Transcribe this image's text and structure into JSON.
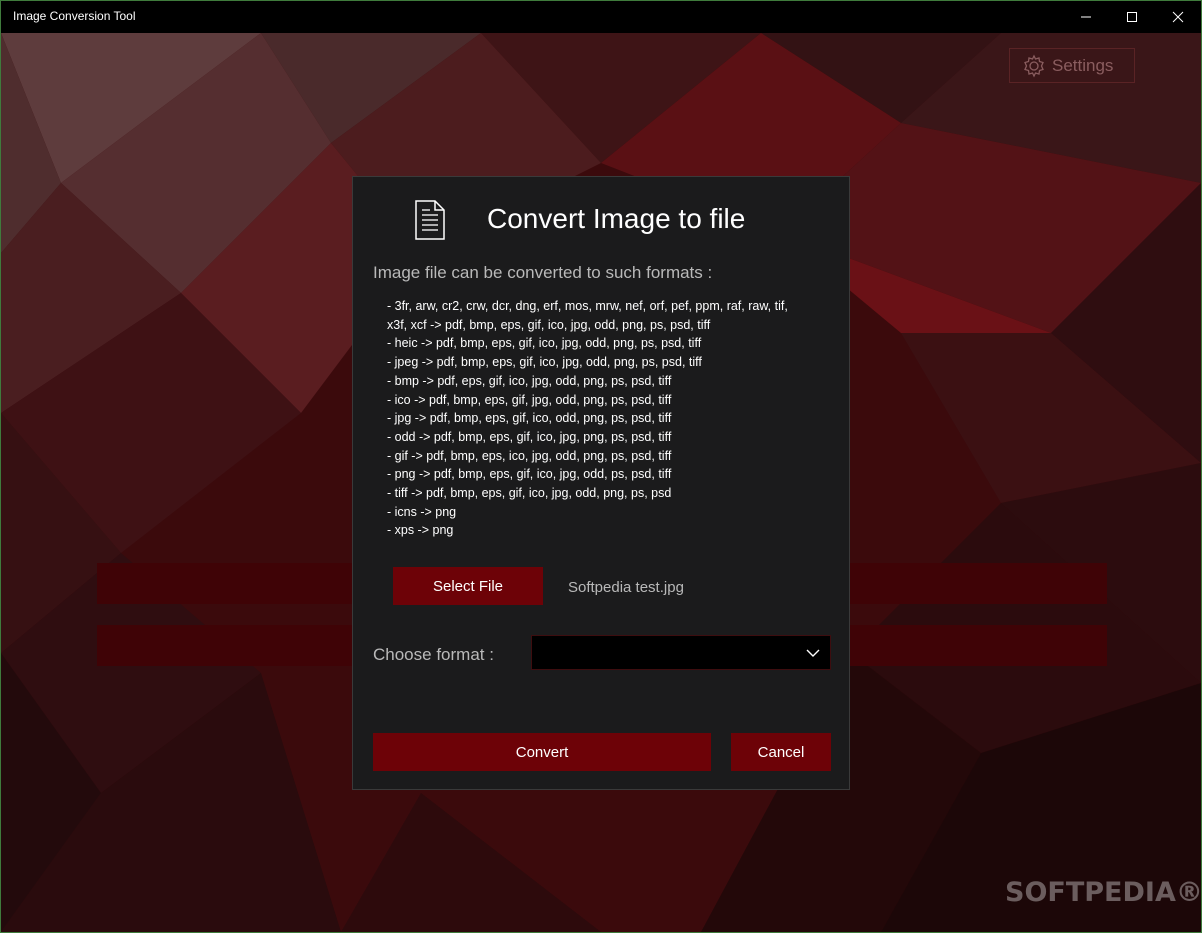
{
  "window": {
    "title": "Image Conversion Tool"
  },
  "settings": {
    "label": "Settings",
    "icon": "gear-icon"
  },
  "dialog": {
    "title": "Convert Image to file",
    "icon": "document-icon",
    "subtitle": "Image file can be converted to such formats :",
    "formats": [
      "- 3fr, arw, cr2, crw, dcr, dng, erf, mos, mrw, nef, orf, pef, ppm, raf, raw, tif,",
      "x3f, xcf -> pdf, bmp, eps, gif, ico, jpg, odd, png, ps, psd, tiff",
      "- heic -> pdf, bmp, eps, gif, ico, jpg, odd, png, ps, psd, tiff",
      "- jpeg -> pdf, bmp, eps, gif, ico, jpg, odd, png, ps, psd, tiff",
      "- bmp -> pdf, eps, gif, ico, jpg, odd, png, ps, psd, tiff",
      "- ico -> pdf, bmp, eps, gif, jpg, odd, png, ps, psd, tiff",
      "- jpg -> pdf, bmp, eps, gif, ico, odd, png, ps, psd, tiff",
      "- odd -> pdf, bmp, eps, gif, ico, jpg, png, ps, psd, tiff",
      "- gif -> pdf, bmp, eps, ico, jpg, odd, png, ps, psd, tiff",
      "- png -> pdf, bmp, eps, gif, ico, jpg, odd, ps, psd, tiff",
      "- tiff -> pdf, bmp, eps, gif, ico, jpg, odd, png, ps, psd",
      "- icns -> png",
      "- xps -> png"
    ],
    "select_file_label": "Select File",
    "selected_file": "Softpedia test.jpg",
    "choose_format_label": "Choose format :",
    "format_value": "",
    "convert_label": "Convert",
    "cancel_label": "Cancel"
  },
  "watermark": "SOFTPEDIA®",
  "colors": {
    "accent": "#6d0207",
    "dialog_bg": "#1b1b1c",
    "background": "#3a0a0c"
  }
}
